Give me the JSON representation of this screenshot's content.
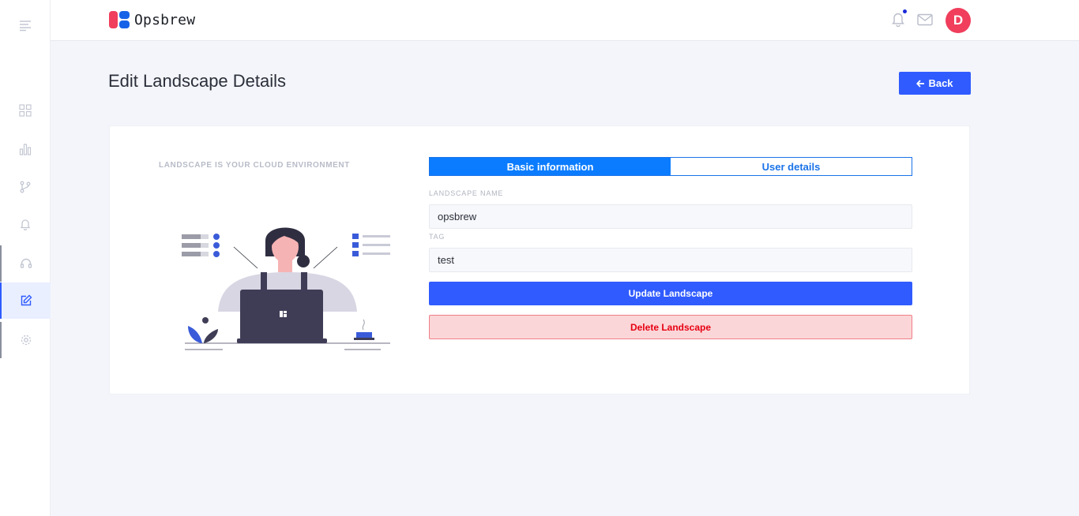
{
  "brand": {
    "name": "Opsbrew"
  },
  "header": {
    "notifications_icon": "bell-icon",
    "mail_icon": "mail-icon",
    "avatar_initial": "D"
  },
  "sidebar": {
    "items": [
      {
        "name": "menu",
        "icon": "hamburger-icon"
      },
      {
        "name": "dashboard",
        "icon": "grid-icon"
      },
      {
        "name": "analytics",
        "icon": "bar-chart-icon"
      },
      {
        "name": "branches",
        "icon": "git-branch-icon"
      },
      {
        "name": "alerts",
        "icon": "bell-icon"
      },
      {
        "name": "support",
        "icon": "headset-icon"
      },
      {
        "name": "edit",
        "icon": "edit-icon",
        "active": true
      },
      {
        "name": "settings",
        "icon": "gear-icon"
      }
    ]
  },
  "page": {
    "title": "Edit Landscape Details",
    "back_label": "Back"
  },
  "illustration": {
    "caption": "LANDSCAPE IS YOUR CLOUD ENVIRONMENT"
  },
  "tabs": [
    {
      "label": "Basic information",
      "active": true
    },
    {
      "label": "User details",
      "active": false
    }
  ],
  "form": {
    "name_label": "LANDSCAPE NAME",
    "name_value": "opsbrew",
    "tag_label": "TAG",
    "tag_value": "test",
    "update_label": "Update Landscape",
    "delete_label": "Delete Landscape"
  },
  "colors": {
    "primary": "#2f5bff",
    "tab_active": "#0b7cff",
    "brand_red": "#f03e5c",
    "brand_blue": "#1763e8",
    "danger_text": "#e60012",
    "danger_bg": "#fbd6d8"
  }
}
